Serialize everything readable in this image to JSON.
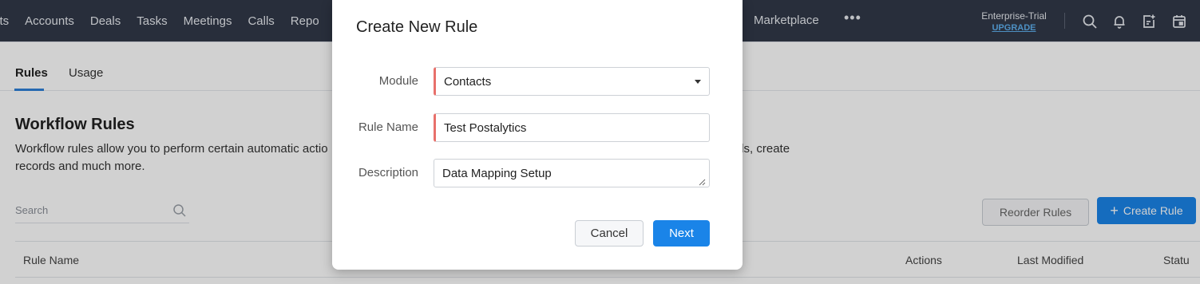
{
  "topnav": {
    "items": [
      "cts",
      "Accounts",
      "Deals",
      "Tasks",
      "Meetings",
      "Calls",
      "Repo"
    ],
    "marketplace": "Marketplace",
    "more": "•••",
    "plan_name": "Enterprise-Trial",
    "upgrade": "UPGRADE",
    "icons": [
      "search-icon",
      "bell-icon",
      "add-note-icon",
      "calendar-icon"
    ]
  },
  "subtabs": [
    "Rules",
    "Usage"
  ],
  "workflow": {
    "title": "Workflow Rules",
    "description": "Workflow rules allow you to perform certain automatic actio                                                                                                mails, update fields, create records and much more."
  },
  "search": {
    "placeholder": "Search"
  },
  "buttons": {
    "reorder": "Reorder Rules",
    "create_plus": "+",
    "create": "Create Rule"
  },
  "table": {
    "headers": [
      "Rule Name",
      "Actions",
      "Last Modified",
      "Statu"
    ]
  },
  "modal": {
    "title": "Create New Rule",
    "fields": [
      {
        "label": "Module",
        "value": "Contacts"
      },
      {
        "label": "Rule Name",
        "value": "Test Postalytics"
      },
      {
        "label": "Description",
        "value": "Data Mapping Setup"
      }
    ],
    "cancel": "Cancel",
    "next": "Next"
  },
  "colors": {
    "nav_bg": "#313949",
    "accent": "#1a84e8",
    "required": "#e8706b"
  }
}
